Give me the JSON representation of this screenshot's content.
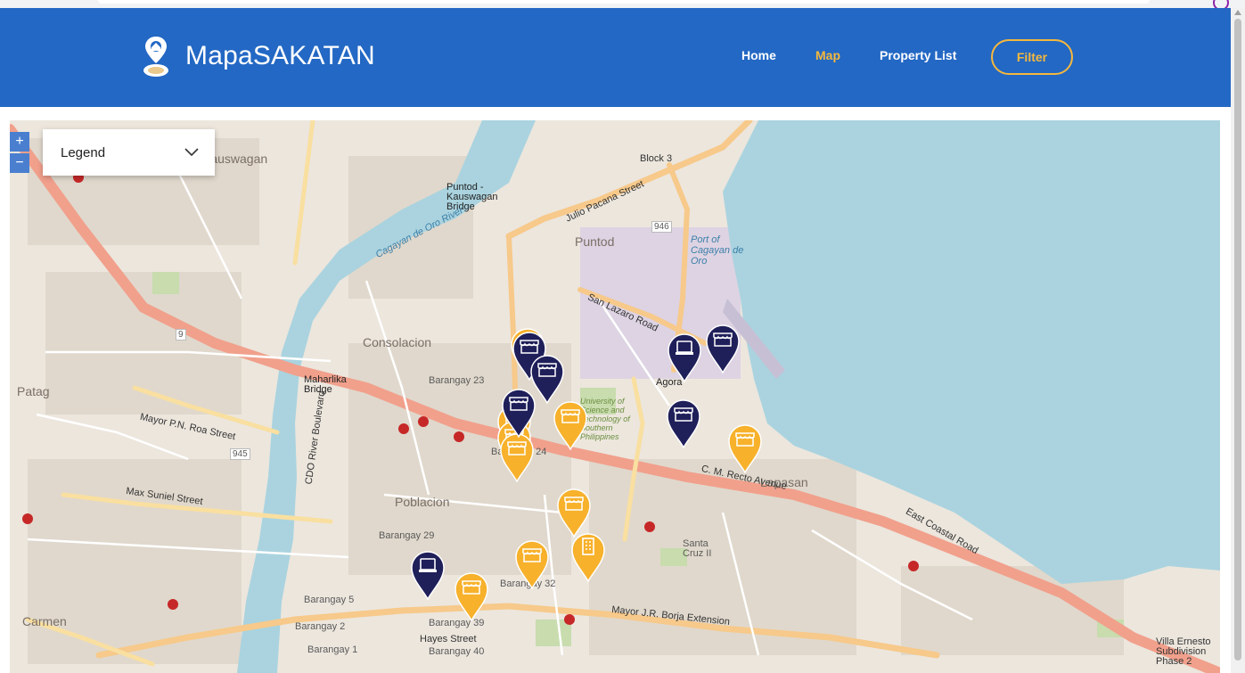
{
  "app": {
    "title": "MapaSAKATAN"
  },
  "nav": {
    "home": "Home",
    "map": "Map",
    "property_list": "Property List",
    "filter": "Filter"
  },
  "map": {
    "legend_label": "Legend",
    "zoom_in": "+",
    "zoom_out": "−",
    "labels": {
      "kauswagan": "Kauswagan",
      "puntod": "Puntod",
      "port": "Port of Cagayan de Oro",
      "bridge": "Puntod - Kauswagan Bridge",
      "river": "Cagayan de Oro River",
      "consolacion": "Consolacion",
      "barangay23": "Barangay 23",
      "barangay24": "Barangay 24",
      "maharlika": "Maharlika Bridge",
      "patag": "Patag",
      "poblacion": "Poblacion",
      "barangay29": "Barangay 29",
      "barangay32": "Barangay 32",
      "barangay39": "Barangay 39",
      "barangay40": "Barangay 40",
      "barangay5": "Barangay 5",
      "barangay2": "Barangay 2",
      "barangay1": "Barangay 1",
      "carmen": "Carmen",
      "lapasan": "Lapasan",
      "agora": "Agora",
      "santa_cruz": "Santa Cruz II",
      "ustp": "University of Science and Technology of Southern Philippines",
      "cm_recto": "C. M. Recto Avenue",
      "east_coastal": "East Coastal Road",
      "borja": "Mayor J.R. Borja Extension",
      "julio_pacana": "Julio Pacana Street",
      "san_lazaro": "San Lazaro Road",
      "roa": "Mayor P.N. Roa Street",
      "max_suniel": "Max Suniel Street",
      "cdo_river_blvd": "CDO River Boulevard",
      "hayes": "Hayes Street",
      "villa_ernesto": "Villa Ernesto Subdivision Phase 2",
      "block3": "Block 3",
      "route946": "946",
      "route945": "945",
      "route9": "9"
    }
  },
  "colors": {
    "navbar": "#2368c4",
    "accent": "#f5b83d",
    "water": "#aad3df",
    "marker_yellow": "#f7b12b",
    "marker_navy": "#1f1f5a"
  },
  "markers": [
    {
      "icon": "storefront-icon",
      "color": "yellow"
    },
    {
      "icon": "storefront-icon",
      "color": "navy"
    },
    {
      "icon": "storefront-icon",
      "color": "navy"
    },
    {
      "icon": "storefront-icon",
      "color": "yellow"
    },
    {
      "icon": "storefront-icon",
      "color": "yellow"
    },
    {
      "icon": "storefront-icon",
      "color": "yellow"
    },
    {
      "icon": "office-icon",
      "color": "navy"
    },
    {
      "icon": "storefront-icon",
      "color": "navy"
    },
    {
      "icon": "storefront-icon",
      "color": "navy"
    },
    {
      "icon": "storefront-icon",
      "color": "yellow"
    },
    {
      "icon": "storefront-icon",
      "color": "navy"
    },
    {
      "icon": "storefront-icon",
      "color": "yellow"
    },
    {
      "icon": "storefront-icon",
      "color": "yellow"
    },
    {
      "icon": "building-icon",
      "color": "yellow"
    },
    {
      "icon": "storefront-icon",
      "color": "yellow"
    },
    {
      "icon": "office-icon",
      "color": "navy"
    },
    {
      "icon": "storefront-icon",
      "color": "yellow"
    }
  ]
}
